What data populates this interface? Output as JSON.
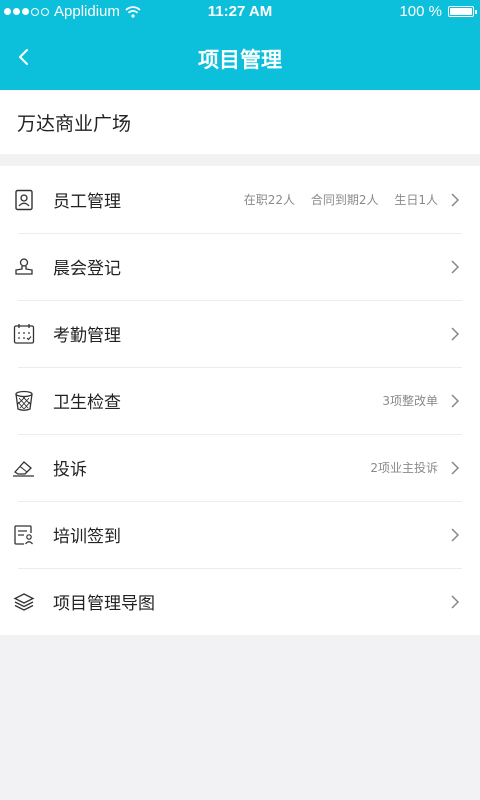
{
  "status_bar": {
    "carrier": "Applidium",
    "time": "11:27 AM",
    "battery": "100 %",
    "signal_dots_filled": 3,
    "signal_dots_total": 5
  },
  "nav": {
    "title": "项目管理",
    "back_icon": "chevron-left-icon"
  },
  "project": {
    "name": "万达商业广场"
  },
  "menu": [
    {
      "label": "员工管理",
      "icon": "employee-card-icon",
      "meta": [
        "在职22人",
        "合同到期2人",
        "生日1人"
      ]
    },
    {
      "label": "晨会登记",
      "icon": "stamp-icon",
      "meta": []
    },
    {
      "label": "考勤管理",
      "icon": "calendar-icon",
      "meta": []
    },
    {
      "label": "卫生检查",
      "icon": "trash-bin-icon",
      "meta": [
        "3项整改单"
      ]
    },
    {
      "label": "投诉",
      "icon": "eraser-icon",
      "meta": [
        "2项业主投诉"
      ]
    },
    {
      "label": "培训签到",
      "icon": "signin-form-icon",
      "meta": []
    },
    {
      "label": "项目管理导图",
      "icon": "layers-icon",
      "meta": []
    }
  ],
  "colors": {
    "header": "#0cc0dc",
    "background": "#f2f2f4",
    "meta_text": "#8a8a8a"
  }
}
